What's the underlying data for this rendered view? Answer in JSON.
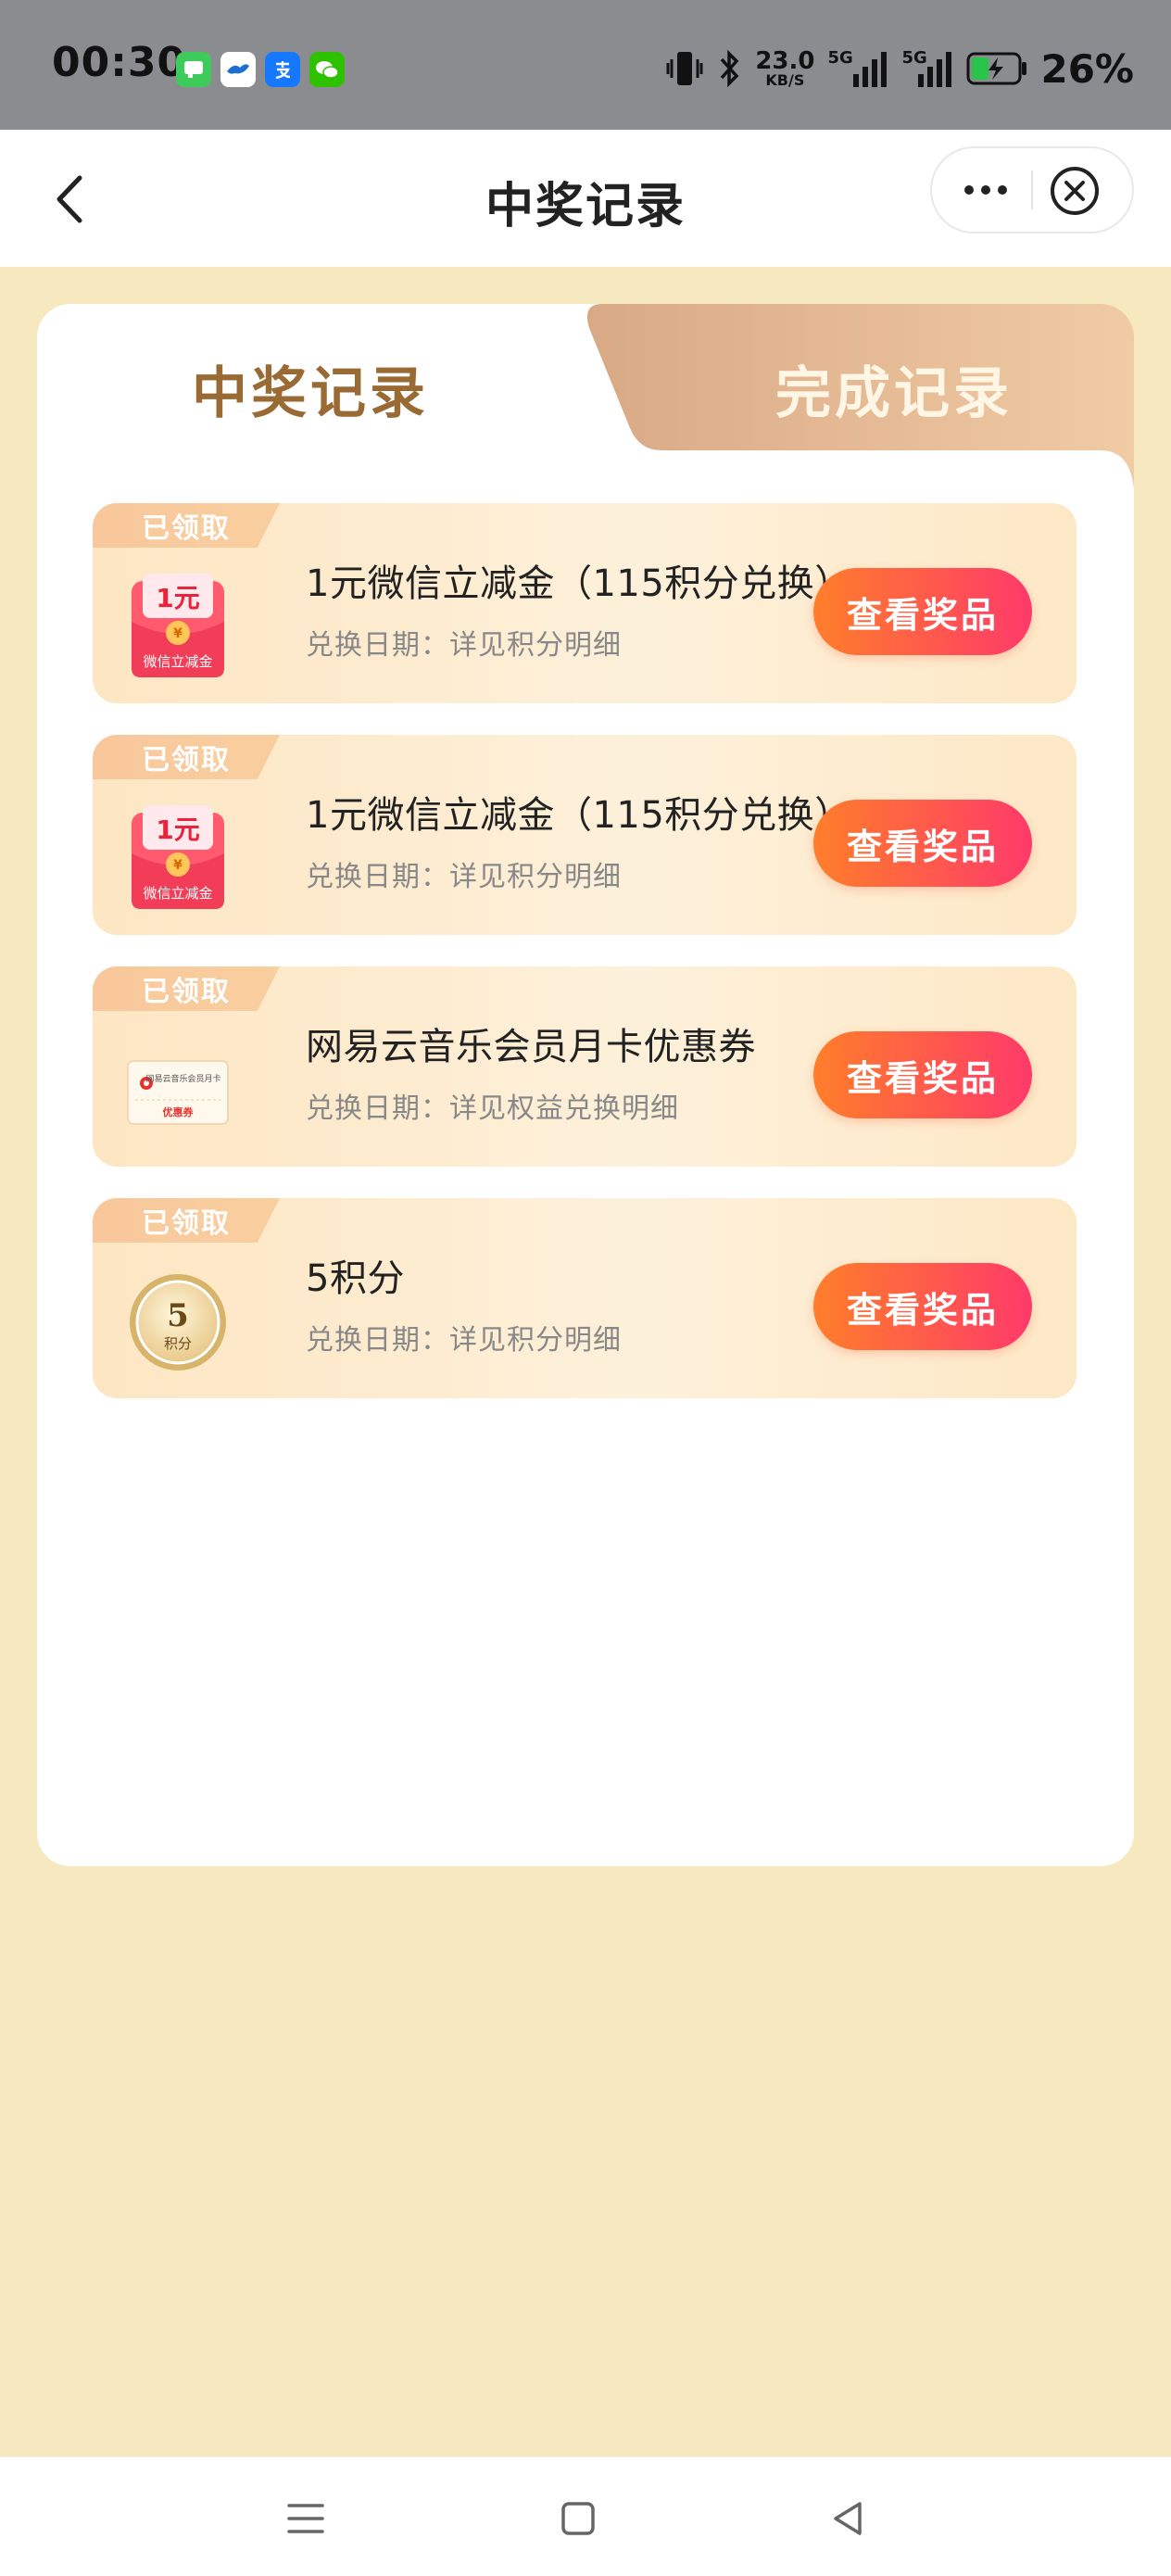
{
  "status_bar": {
    "time": "00:30",
    "speed_value": "23.0",
    "speed_unit": "KB/S",
    "net1": "5G",
    "net2": "5G",
    "battery": "26%"
  },
  "nav": {
    "title": "中奖记录"
  },
  "tabs": [
    {
      "label": "中奖记录",
      "active": true
    },
    {
      "label": "完成记录",
      "active": false
    }
  ],
  "records": [
    {
      "badge": "已领取",
      "icon": "red-envelope-icon",
      "thumb_text": "1元",
      "thumb_caption": "微信立减金",
      "title": "1元微信立减金（115积分兑换）",
      "subtitle": "兑换日期：详见积分明细",
      "button": "查看奖品"
    },
    {
      "badge": "已领取",
      "icon": "red-envelope-icon",
      "thumb_text": "1元",
      "thumb_caption": "微信立减金",
      "title": "1元微信立减金（115积分兑换）",
      "subtitle": "兑换日期：详见积分明细",
      "button": "查看奖品"
    },
    {
      "badge": "已领取",
      "icon": "coupon-ticket-icon",
      "thumb_text": "网易云音乐会员月卡",
      "thumb_caption": "优惠券",
      "title": "网易云音乐会员月卡优惠券",
      "subtitle": "兑换日期：详见权益兑换明细",
      "button": "查看奖品"
    },
    {
      "badge": "已领取",
      "icon": "points-coin-icon",
      "thumb_text": "5",
      "thumb_caption": "积分",
      "title": "5积分",
      "subtitle": "兑换日期：详见积分明细",
      "button": "查看奖品"
    }
  ],
  "colors": {
    "page_bg": "#f7e9bf",
    "tab_active_text": "#9a6a34",
    "button_start": "#ff7e2a",
    "button_end": "#ff3a6a"
  }
}
